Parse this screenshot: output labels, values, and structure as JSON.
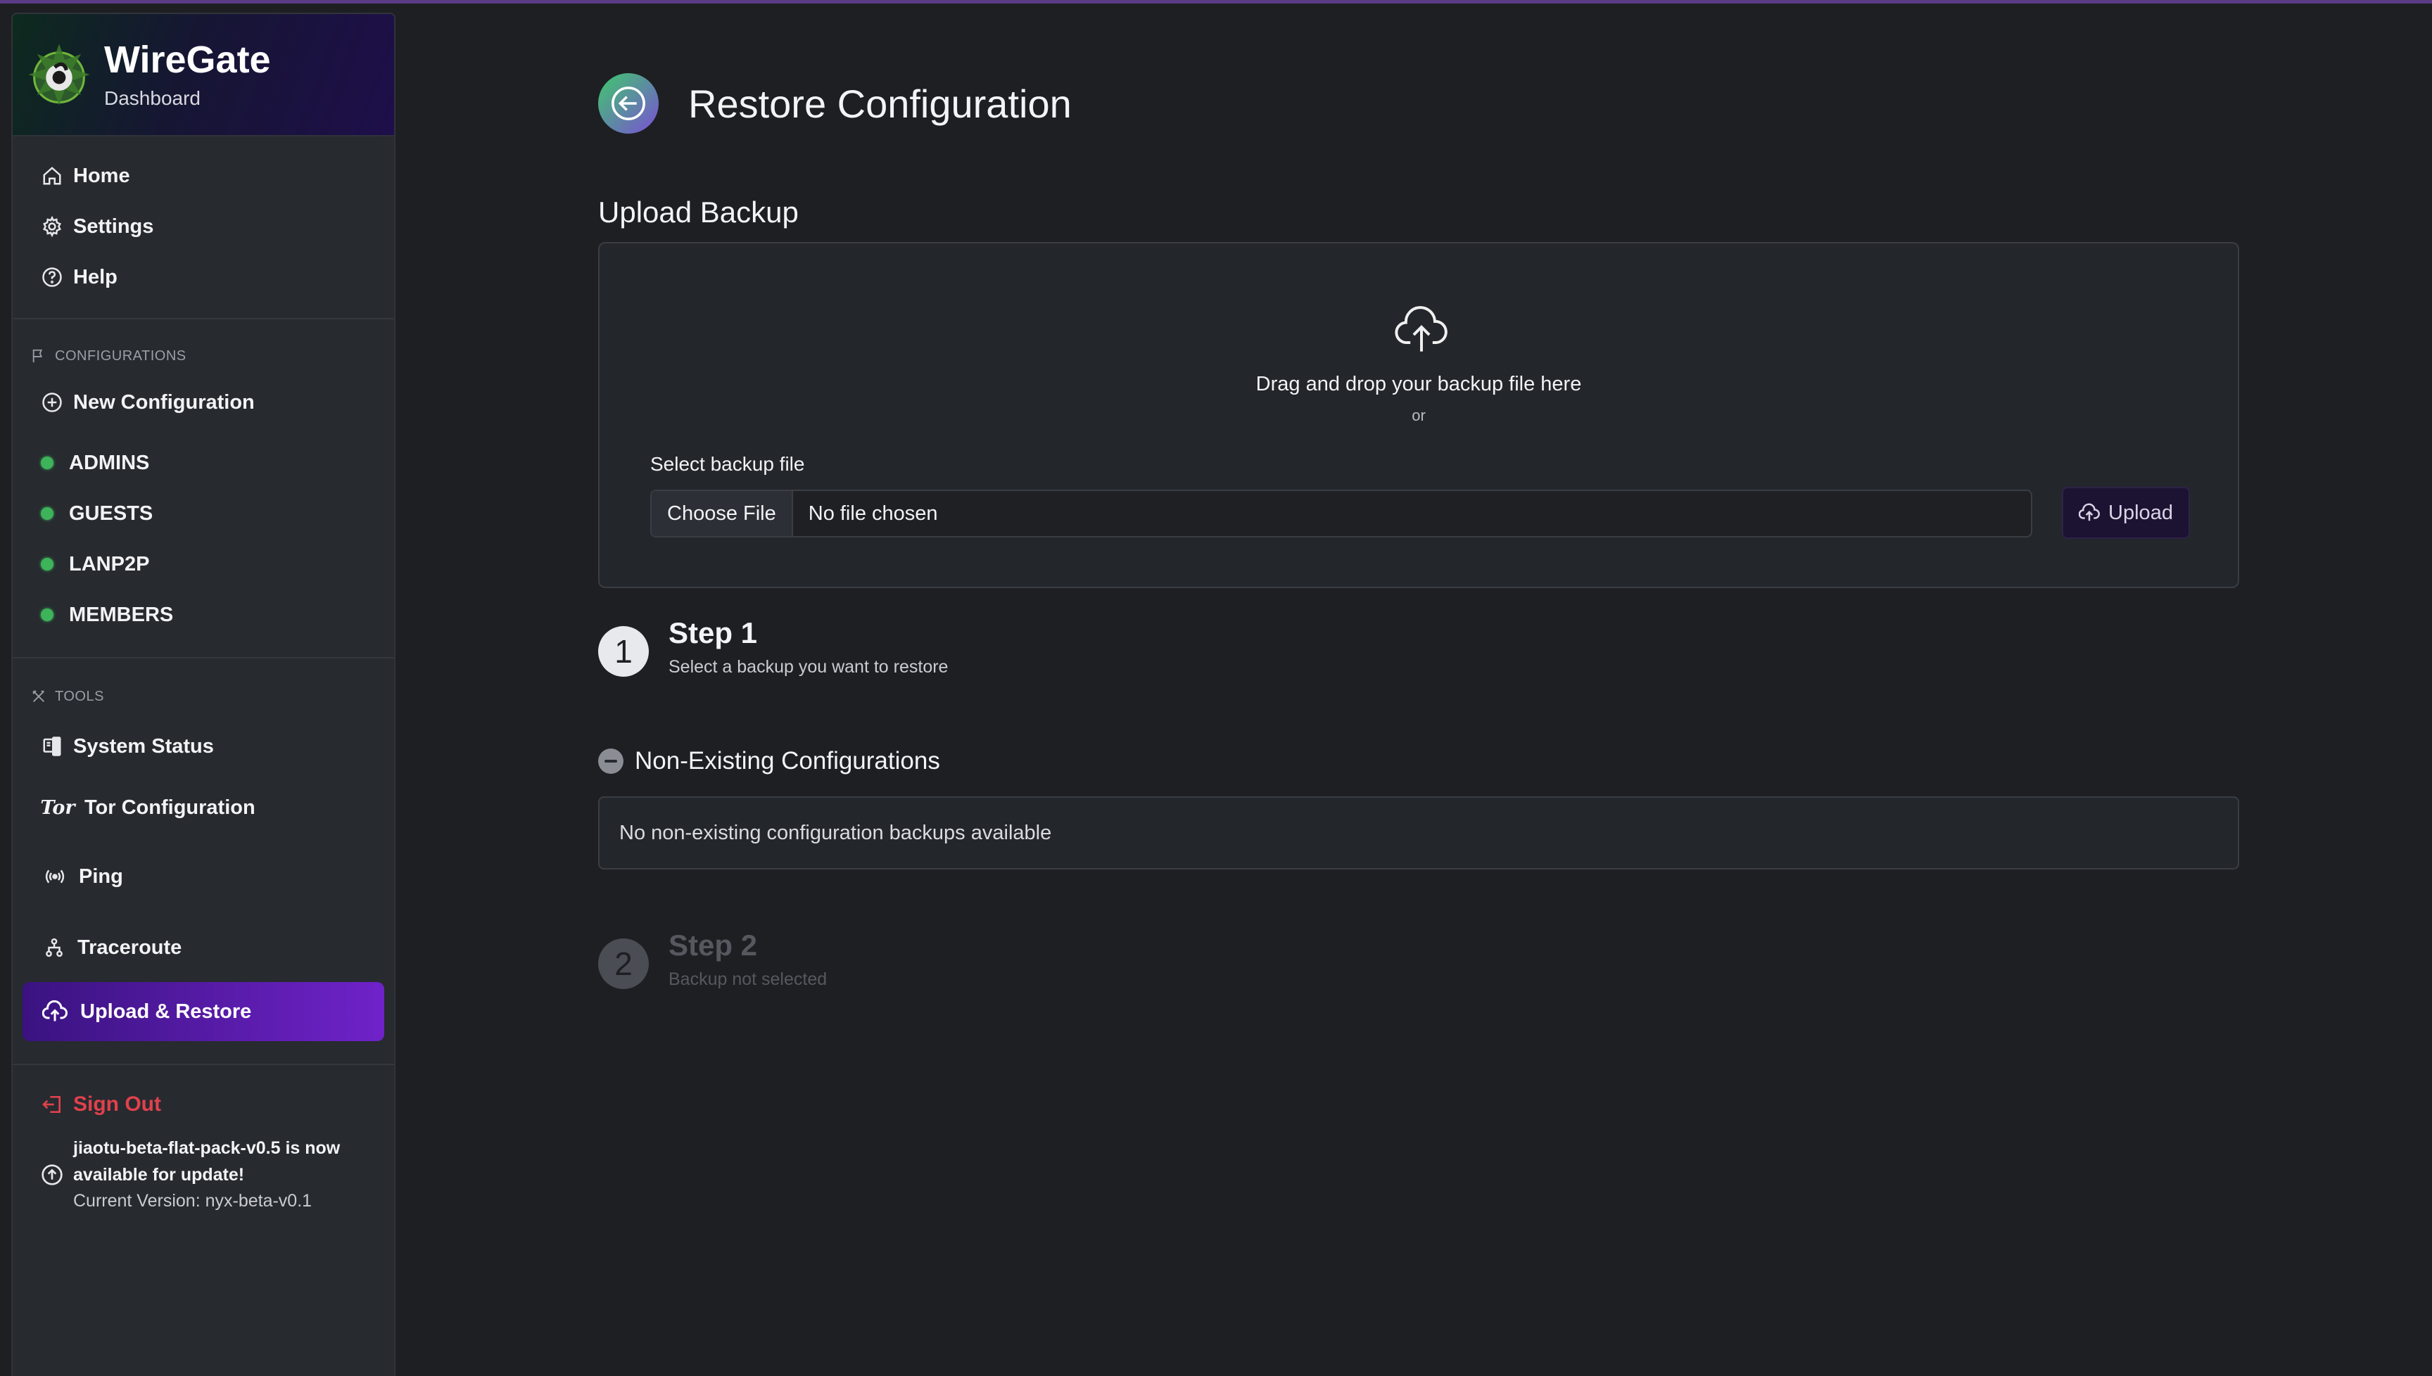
{
  "brand": {
    "title": "WireGate",
    "subtitle": "Dashboard"
  },
  "nav": {
    "home": "Home",
    "settings": "Settings",
    "help": "Help"
  },
  "configurations": {
    "section_label": "CONFIGURATIONS",
    "new_label": "New Configuration",
    "items": [
      {
        "name": "ADMINS",
        "status_color": "#3db35a"
      },
      {
        "name": "GUESTS",
        "status_color": "#3db35a"
      },
      {
        "name": "LANP2P",
        "status_color": "#3db35a"
      },
      {
        "name": "MEMBERS",
        "status_color": "#3db35a"
      }
    ]
  },
  "tools": {
    "section_label": "TOOLS",
    "items": [
      {
        "label": "System Status",
        "icon": "server-icon"
      },
      {
        "label": "Tor Configuration",
        "icon": "tor-icon"
      },
      {
        "label": "Ping",
        "icon": "broadcast-icon"
      },
      {
        "label": "Traceroute",
        "icon": "diagram-icon"
      }
    ],
    "active": {
      "label": "Upload & Restore",
      "icon": "cloud-upload-icon"
    }
  },
  "account": {
    "signout": "Sign Out",
    "update_message": "jiaotu-beta-flat-pack-v0.5 is now available for update!",
    "update_line1": "jiaotu-beta-flat-pack-v0.5 is now",
    "update_line2": "available for update!",
    "current_version": "Current Version: nyx-beta-v0.1"
  },
  "page": {
    "title": "Restore Configuration",
    "upload_heading": "Upload Backup",
    "dropzone_text": "Drag and drop your backup file here",
    "or_text": "or",
    "file_label": "Select backup file",
    "choose_file": "Choose File",
    "file_status": "No file chosen",
    "upload_button": "Upload"
  },
  "steps": [
    {
      "number": "1",
      "title": "Step 1",
      "subtitle": "Select a backup you want to restore",
      "active": true
    },
    {
      "number": "2",
      "title": "Step 2",
      "subtitle": "Backup not selected",
      "active": false
    }
  ],
  "non_existing": {
    "heading": "Non-Existing Configurations",
    "empty_message": "No non-existing configuration backups available"
  },
  "colors": {
    "background": "#1d1f23",
    "sidebar": "#272a2f",
    "accent_purple": "#6f22c9",
    "status_green": "#3db35a",
    "danger_red": "#e0414c"
  }
}
